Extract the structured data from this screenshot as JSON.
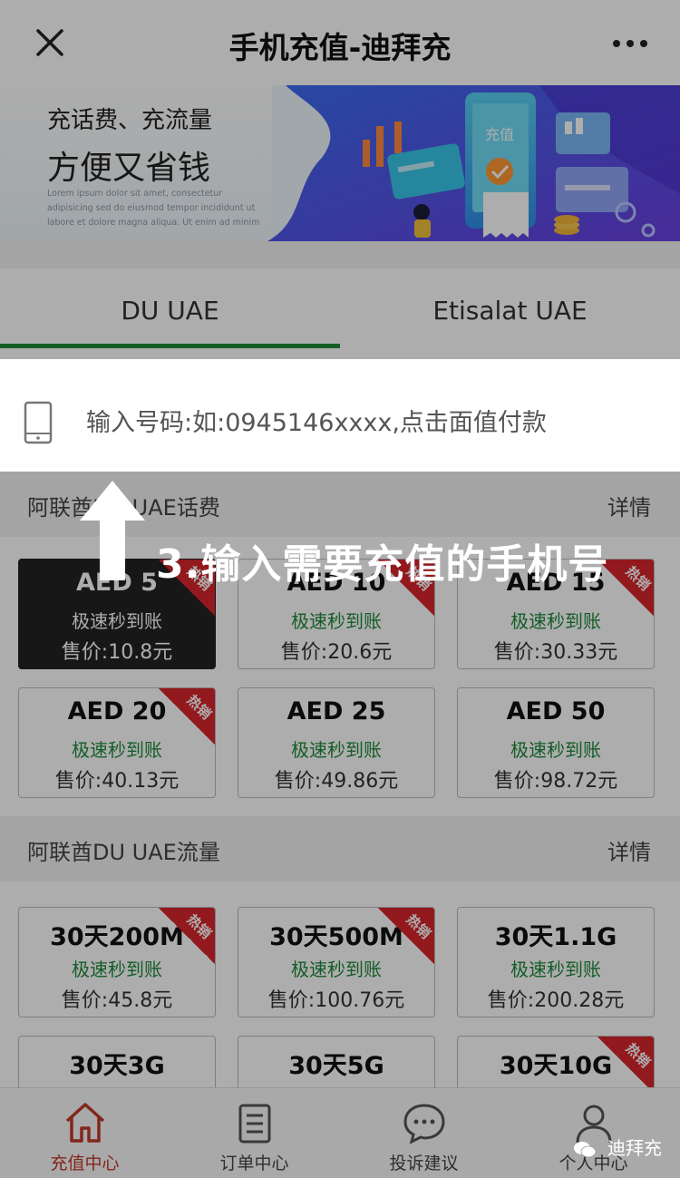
{
  "header": {
    "title": "手机充值-迪拜充"
  },
  "banner": {
    "line1": "充话费、充流量",
    "line2": "方便又省钱",
    "lorem": "Lorem ipsum dolor sit amet, consectetur adipisicing sed do eiusmod tempor incididunt ut labore et dolore magna aliqua. Ut enim ad minim",
    "card_text": "充值"
  },
  "tabs": [
    {
      "label": "DU UAE",
      "active": true
    },
    {
      "label": "Etisalat UAE",
      "active": false
    }
  ],
  "phone_input": {
    "placeholder": "输入号码:如:0945146xxxx,点击面值付款",
    "value": ""
  },
  "annotation": {
    "text": "3.输入需要充值的手机号"
  },
  "sections": [
    {
      "title": "阿联酋DU UAE话费",
      "link": "详情",
      "cards": [
        {
          "name": "AED 5",
          "speed": "极速秒到账",
          "price": "售价:10.8元",
          "hot": true,
          "selected": true
        },
        {
          "name": "AED 10",
          "speed": "极速秒到账",
          "price": "售价:20.6元",
          "hot": true,
          "selected": false
        },
        {
          "name": "AED 15",
          "speed": "极速秒到账",
          "price": "售价:30.33元",
          "hot": true,
          "selected": false
        },
        {
          "name": "AED 20",
          "speed": "极速秒到账",
          "price": "售价:40.13元",
          "hot": true,
          "selected": false
        },
        {
          "name": "AED 25",
          "speed": "极速秒到账",
          "price": "售价:49.86元",
          "hot": false,
          "selected": false
        },
        {
          "name": "AED 50",
          "speed": "极速秒到账",
          "price": "售价:98.72元",
          "hot": false,
          "selected": false
        }
      ]
    },
    {
      "title": "阿联酋DU UAE流量",
      "link": "详情",
      "cards": [
        {
          "name": "30天200M",
          "speed": "极速秒到账",
          "price": "售价:45.8元",
          "hot": true,
          "selected": false
        },
        {
          "name": "30天500M",
          "speed": "极速秒到账",
          "price": "售价:100.76元",
          "hot": true,
          "selected": false
        },
        {
          "name": "30天1.1G",
          "speed": "极速秒到账",
          "price": "售价:200.28元",
          "hot": false,
          "selected": false
        },
        {
          "name": "30天3G",
          "speed": "",
          "price": "",
          "hot": false,
          "selected": false
        },
        {
          "name": "30天5G",
          "speed": "",
          "price": "",
          "hot": false,
          "selected": false
        },
        {
          "name": "30天10G",
          "speed": "",
          "price": "",
          "hot": true,
          "selected": false
        }
      ]
    }
  ],
  "hot_label": "热销",
  "bottom_nav": [
    {
      "label": "充值中心",
      "icon": "home-icon",
      "active": true
    },
    {
      "label": "订单中心",
      "icon": "clipboard-icon",
      "active": false
    },
    {
      "label": "投诉建议",
      "icon": "chat-bubble-icon",
      "active": false
    },
    {
      "label": "个人中心",
      "icon": "user-icon",
      "active": false
    }
  ],
  "watermark": {
    "text": "迪拜充"
  },
  "colors": {
    "accent_green": "#1e8a3a",
    "hot_red": "#d8262c",
    "nav_active": "#c0392b"
  }
}
